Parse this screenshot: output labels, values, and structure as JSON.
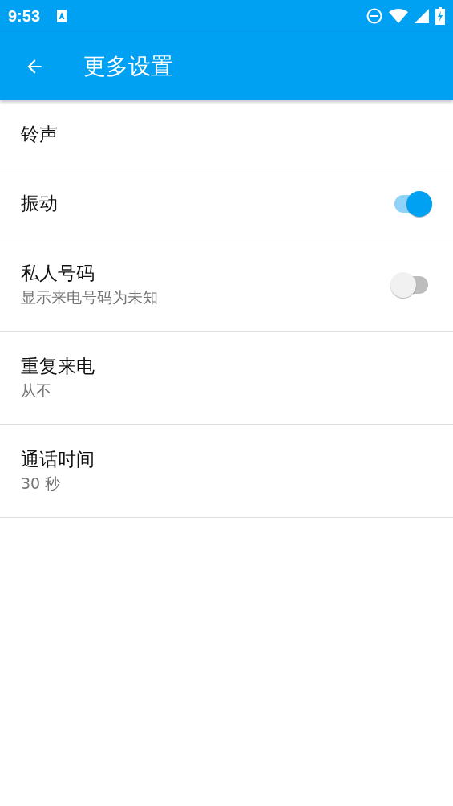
{
  "status_bar": {
    "time": "9:53"
  },
  "app_bar": {
    "title": "更多设置"
  },
  "settings": [
    {
      "kind": "plain",
      "title": "铃声"
    },
    {
      "kind": "switch",
      "title": "振动",
      "on": true
    },
    {
      "kind": "switch",
      "title": "私人号码",
      "subtitle": "显示来电号码为未知",
      "on": false
    },
    {
      "kind": "plain",
      "title": "重复来电",
      "subtitle": "从不"
    },
    {
      "kind": "plain",
      "title": "通话时间",
      "subtitle": "30 秒"
    }
  ]
}
